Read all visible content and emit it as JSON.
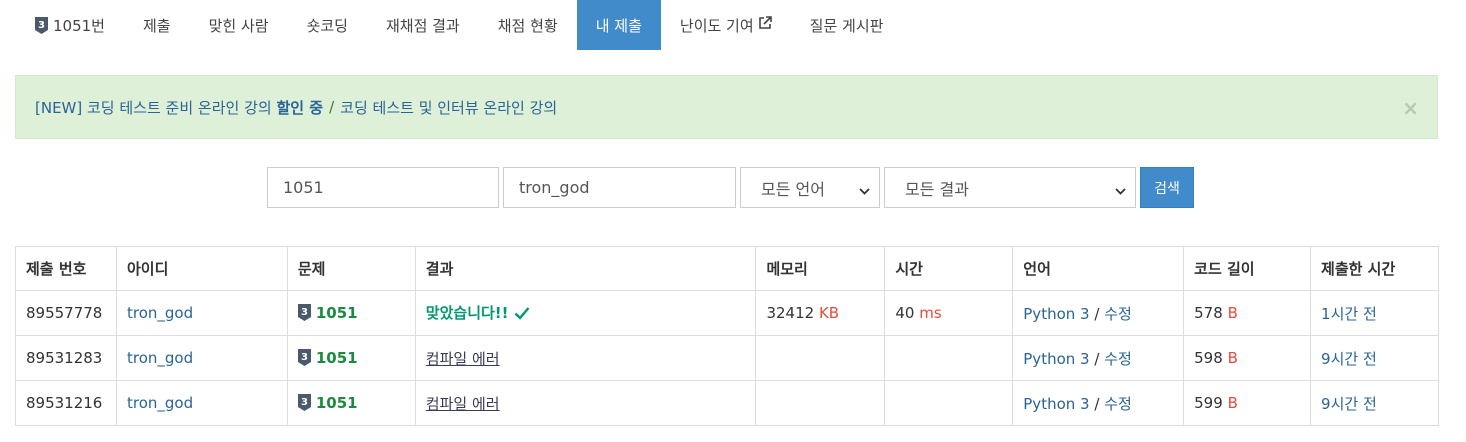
{
  "nav": {
    "problem_label": "1051번",
    "problem_tier": "3",
    "items": [
      {
        "label": "제출"
      },
      {
        "label": "맞힌 사람"
      },
      {
        "label": "숏코딩"
      },
      {
        "label": "재채점 결과"
      },
      {
        "label": "채점 현황"
      },
      {
        "label": "내 제출",
        "active": true
      },
      {
        "label": "난이도 기여"
      },
      {
        "label": "질문 게시판"
      }
    ]
  },
  "alert": {
    "part1": "[NEW] 코딩 테스트 준비 온라인 강의",
    "bold": "할인 중",
    "sep": "/",
    "part2": "코딩 테스트 및 인터뷰 온라인 강의",
    "close": "×"
  },
  "form": {
    "problem_id": "1051",
    "user_id": "tron_god",
    "language": "모든 언어",
    "result": "모든 결과",
    "search_label": "검색"
  },
  "table": {
    "headers": [
      "제출 번호",
      "아이디",
      "문제",
      "결과",
      "메모리",
      "시간",
      "언어",
      "코드 길이",
      "제출한 시간"
    ],
    "rows": [
      {
        "id": "89557778",
        "user": "tron_god",
        "tier": "3",
        "problem": "1051",
        "result": "맞았습니다!!",
        "memory": "32412",
        "memory_unit": "KB",
        "time": "40",
        "time_unit": "ms",
        "lang": "Python 3",
        "lang_sep": "/",
        "edit": "수정",
        "length": "578",
        "length_unit": "B",
        "submitted": "1시간 전"
      },
      {
        "id": "89531283",
        "user": "tron_god",
        "tier": "3",
        "problem": "1051",
        "result": "컴파일 에러",
        "memory": "",
        "memory_unit": "",
        "time": "",
        "time_unit": "",
        "lang": "Python 3",
        "lang_sep": "/",
        "edit": "수정",
        "length": "598",
        "length_unit": "B",
        "submitted": "9시간 전"
      },
      {
        "id": "89531216",
        "user": "tron_god",
        "tier": "3",
        "problem": "1051",
        "result": "컴파일 에러",
        "memory": "",
        "memory_unit": "",
        "time": "",
        "time_unit": "",
        "lang": "Python 3",
        "lang_sep": "/",
        "edit": "수정",
        "length": "599",
        "length_unit": "B",
        "submitted": "9시간 전"
      }
    ]
  },
  "colors": {
    "accent": "#428bca",
    "alert_bg": "#dff0d8",
    "accepted": "#009874",
    "tier_badge": "#4a5a6a"
  }
}
